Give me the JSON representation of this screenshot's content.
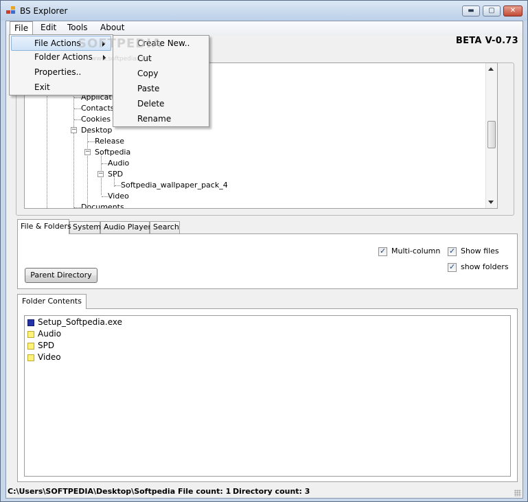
{
  "window": {
    "title": "BS Explorer"
  },
  "menubar": {
    "file": "File",
    "edit": "Edit",
    "tools": "Tools",
    "about": "About"
  },
  "version_label": "BETA  V-0.73",
  "file_menu": {
    "items": [
      "File Actions",
      "Folder Actions",
      "Properties..",
      "Exit"
    ]
  },
  "file_actions_submenu": {
    "items": [
      "Create New..",
      "Cut",
      "Copy",
      "Paste",
      "Delete",
      "Rename"
    ]
  },
  "tree": {
    "nodes": [
      "Applicatio",
      "Contacts",
      "Cookies",
      "Desktop",
      "Release",
      "Softpedia",
      "Audio",
      "SPD",
      "Softpedia_wallpaper_pack_4",
      "Video",
      "Documents"
    ]
  },
  "tabs": [
    "File & Folders",
    "System",
    "Audio Player",
    "Search"
  ],
  "options": {
    "multi_column": "Multi-column",
    "show_files": "Show files",
    "show_folders": "show folders",
    "multi_column_checked": true,
    "show_files_checked": true,
    "show_folders_checked": true
  },
  "parent_directory_button": "Parent Directory",
  "folder_contents": {
    "tab_label": "Folder Contents",
    "items": [
      {
        "name": "Setup_Softpedia.exe",
        "icon": "exe-icon"
      },
      {
        "name": "Audio",
        "icon": "folder-icon"
      },
      {
        "name": "SPD",
        "icon": "folder-icon"
      },
      {
        "name": "Video",
        "icon": "folder-icon"
      }
    ]
  },
  "status": {
    "path": "C:\\Users\\SOFTPEDIA\\Desktop\\Softpedia",
    "file_count": "File count: 1",
    "directory_count": "Directory count: 3"
  },
  "watermark": {
    "text": "SOFTPEDIA",
    "url": "www.softpedia.com"
  },
  "colors": {
    "menu_highlight": "#cfe3f7",
    "folder": "#fff27a",
    "exe": "#2233aa"
  }
}
